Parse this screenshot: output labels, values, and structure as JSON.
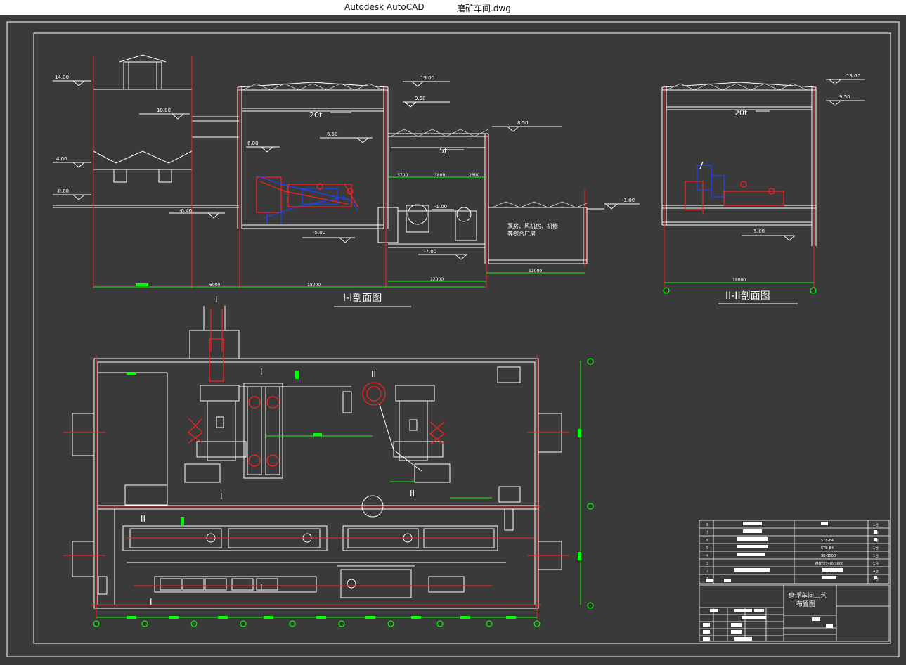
{
  "window": {
    "app_name": "Autodesk AutoCAD",
    "file_name": "磨矿车间.dwg"
  },
  "colors": {
    "background": "#3a3a3a",
    "lines": "#ffffff",
    "dimension": "#00ff00",
    "centerline": "#ff0000",
    "equipment_red": "#ff2020",
    "equipment_blue": "#2040ff"
  },
  "drawing": {
    "section1": {
      "title": "I-I剖面图",
      "elevations": [
        "14.00",
        "10.00",
        "4.00",
        "-0.00",
        "-0.40",
        "6.00",
        "13.00",
        "9.50",
        "6.50",
        "8.50",
        "-5.00",
        "-7.00",
        "-1.00",
        "-1.00"
      ],
      "crane_labels": [
        "20t",
        "5t"
      ],
      "dimensions": [
        "6000",
        "18000",
        "12000",
        "12000",
        "3700",
        "3800",
        "2600"
      ],
      "room_note_line1": "泵房、风机房、机修",
      "room_note_line2": "等综合厂房"
    },
    "section2": {
      "title": "II-II剖面图",
      "elevations": [
        "13.00",
        "9.50",
        "-5.00"
      ],
      "crane_label": "20t",
      "dimension": "18000"
    },
    "plan": {
      "section_marks": [
        "I",
        "I",
        "II",
        "II",
        "I",
        "II",
        "I",
        "I"
      ]
    },
    "title_block": {
      "drawing_title_line1": "磨浮车间工艺",
      "drawing_title_line2": "布置图",
      "rows": [
        {
          "no": "8",
          "model": "",
          "qty": "1台"
        },
        {
          "no": "7",
          "model": "",
          "qty": "1台"
        },
        {
          "no": "6",
          "model": "5ΤB-Β4",
          "qty": "1台"
        },
        {
          "no": "5",
          "model": "5ΤB-Β4",
          "qty": "1台"
        },
        {
          "no": "4",
          "model": "SB-3500",
          "qty": "1台"
        },
        {
          "no": "3",
          "model": "MQY2740X3600",
          "qty": "1台"
        },
        {
          "no": "2",
          "model": "FG-D50",
          "qty": "4台"
        },
        {
          "no": "1",
          "model": "",
          "qty": "1台"
        }
      ]
    }
  }
}
